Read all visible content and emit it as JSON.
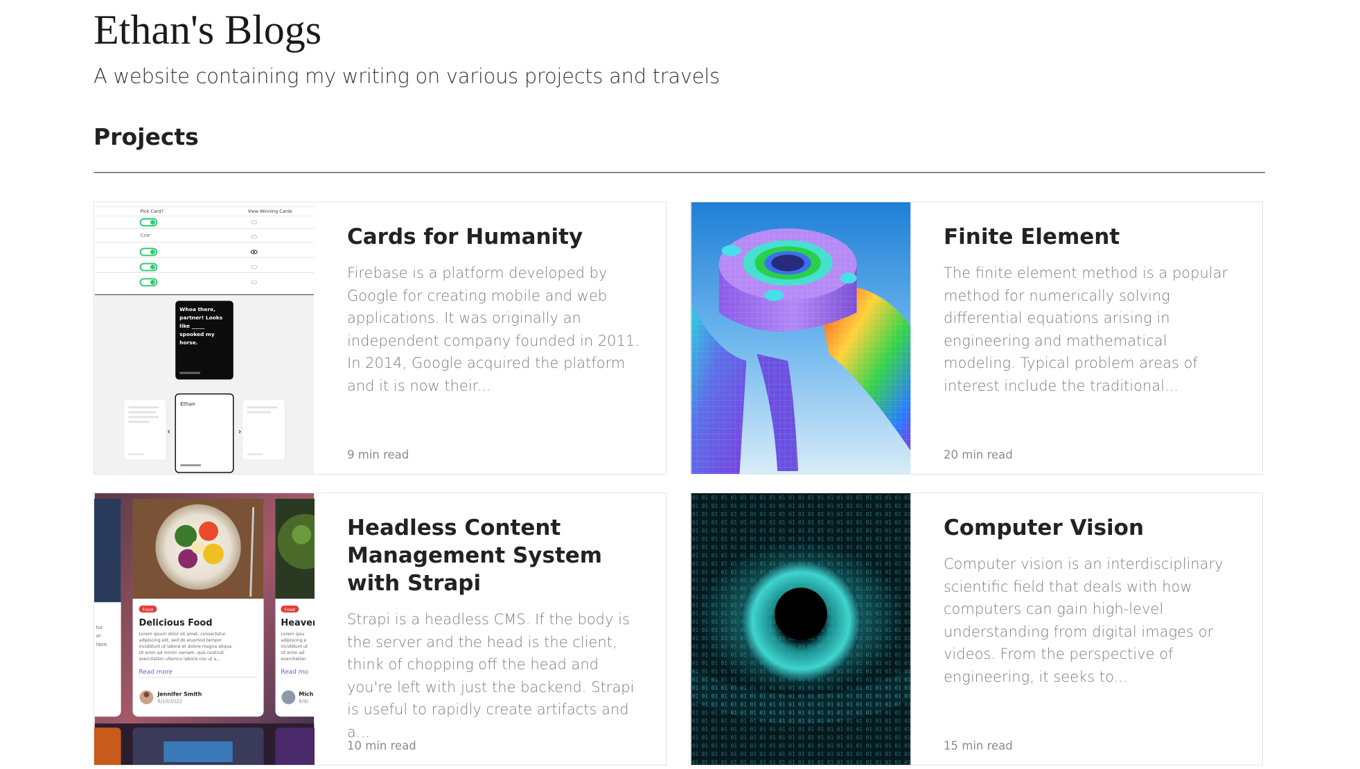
{
  "site": {
    "title": "Ethan's Blogs",
    "subtitle": "A website containing my writing on various projects and travels"
  },
  "section": {
    "title": "Projects"
  },
  "cards": [
    {
      "title": "Cards for Humanity",
      "excerpt": "Firebase is a platform developed by Google for creating mobile and web applications. It was originally an independent company founded in 2011. In 2014, Google acquired the platform and it is now their...",
      "read_time": "9 min read",
      "thumb": {
        "header_left": "Pick Card?",
        "header_right": "View Winning Cards",
        "row_label": "Czar",
        "black_card_text": [
          "Whoa there,",
          "partner! Looks",
          "like _____",
          "spooked my",
          "horse."
        ],
        "white_card_name": "Ethan"
      }
    },
    {
      "title": "Finite Element",
      "excerpt": "The finite element method is a popular method for numerically solving differential equations arising in engineering and mathematical modeling. Typical problem areas of interest include the traditional...",
      "read_time": "20 min read"
    },
    {
      "title": "Headless Content Management System with Strapi",
      "excerpt": "Strapi is a headless CMS. If the body is the server and the head is the client, think of chopping off the head and you're left with just the backend. Strapi is useful to rapidly create artifacts and a...",
      "read_time": "10 min read",
      "thumb": {
        "badge": "Food",
        "food_title": "Delicious Food",
        "food_text": [
          "Lorem ipsum dolor sit amet, consectetur",
          "adipiscing elit, sed do eiusmod tempor",
          "incididunt ut labore et dolore magna aliqua.",
          "Ut enim ad minim veniam, quis nostrud",
          "exercitation ullamco laboris nisi ut a..."
        ],
        "read_more": "Read more",
        "author": "Jennifer Smith",
        "date": "6/10/2022",
        "side_title": "Heaver",
        "side_text": [
          "Lorem ipsu",
          "adipiscing e",
          "incididunt ut",
          "Ut enim ad",
          "exercitation"
        ],
        "side_read_more": "Read mo",
        "side_author": "Mich",
        "side_date": "6/9/",
        "left_text": [
          "tur",
          "or",
          "iqua."
        ]
      }
    },
    {
      "title": "Computer Vision",
      "excerpt": "Computer vision is an interdisciplinary scientific field that deals with how computers can gain high-level understanding from digital images or videos. From the perspective of engineering, it seeks to...",
      "read_time": "15 min read"
    }
  ],
  "colors": {
    "rule": "#8a8a8a",
    "card_border": "#e3e3e3",
    "excerpt": "#7b7b7b",
    "toggle_green": "#2ecc71",
    "food_badge": "#e53935",
    "eye_teal": "#2ec4c4"
  }
}
